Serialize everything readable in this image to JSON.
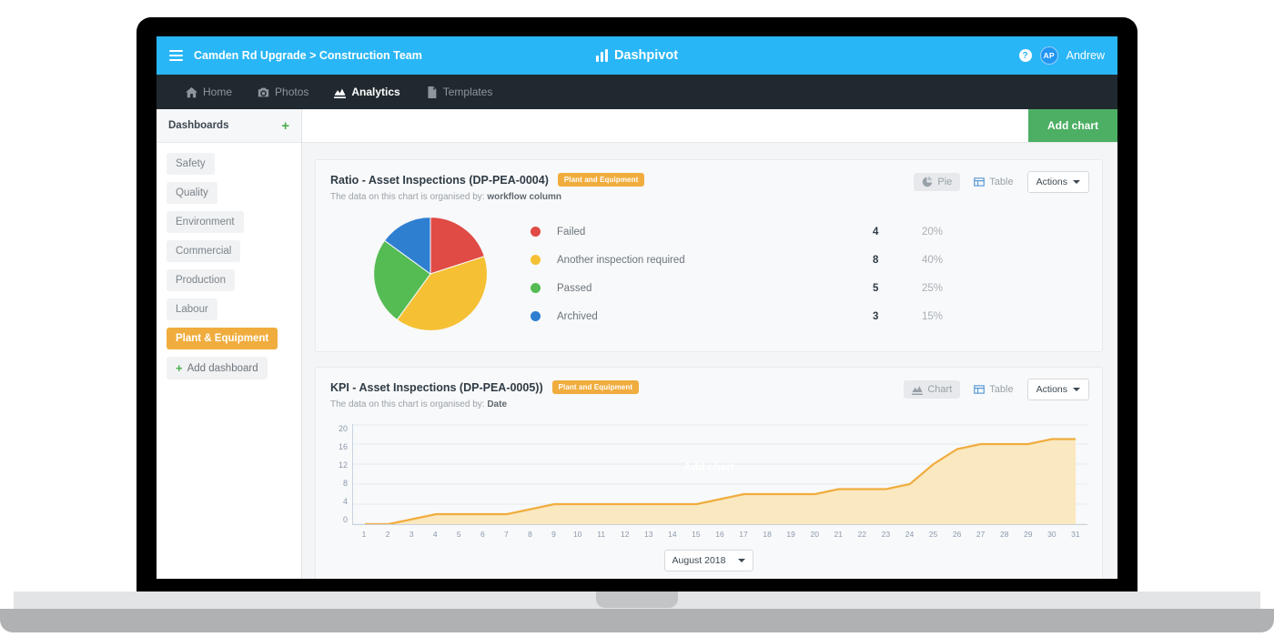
{
  "topbar": {
    "menu_icon": "hamburger-icon",
    "breadcrumb": "Camden Rd Upgrade > Construction Team",
    "brand": "Dashpivot",
    "help_icon": "?",
    "avatar_initials": "AP",
    "user_name": "Andrew"
  },
  "nav": {
    "items": [
      {
        "label": "Home",
        "icon": "home-icon",
        "active": false
      },
      {
        "label": "Photos",
        "icon": "camera-icon",
        "active": false
      },
      {
        "label": "Analytics",
        "icon": "analytics-icon",
        "active": true
      },
      {
        "label": "Templates",
        "icon": "document-icon",
        "active": false
      }
    ]
  },
  "sidebar": {
    "title": "Dashboards",
    "add_icon": "plus-icon",
    "items": [
      {
        "label": "Safety",
        "selected": false
      },
      {
        "label": "Quality",
        "selected": false
      },
      {
        "label": "Environment",
        "selected": false
      },
      {
        "label": "Commercial",
        "selected": false
      },
      {
        "label": "Production",
        "selected": false
      },
      {
        "label": "Labour",
        "selected": false
      },
      {
        "label": "Plant & Equipment",
        "selected": true
      }
    ],
    "add_dashboard_label": "Add dashboard"
  },
  "content_header": {
    "add_chart_label": "Add chart"
  },
  "cards": [
    {
      "title": "Ratio - Asset Inspections (DP-PEA-0004)",
      "tag": "Plant and Equipment",
      "subtitle_prefix": "The data on this chart is organised by:",
      "subtitle_value": "workflow column",
      "tools": {
        "view_label": "Pie",
        "view_icon": "pie-icon",
        "table_label": "Table",
        "table_icon": "table-icon",
        "actions_label": "Actions"
      }
    },
    {
      "title": "KPI - Asset Inspections (DP-PEA-0005))",
      "tag": "Plant and Equipment",
      "subtitle_prefix": "The data on this chart is organised by:",
      "subtitle_value": "Date",
      "tools": {
        "view_label": "Chart",
        "view_icon": "chart-icon",
        "table_label": "Table",
        "table_icon": "table-icon",
        "actions_label": "Actions"
      },
      "watermark": "Add chart",
      "month_selector": "August 2018"
    }
  ],
  "chart_data": [
    {
      "type": "pie",
      "title": "Ratio - Asset Inspections (DP-PEA-0004)",
      "legend_position": "right",
      "labels": [
        "Failed",
        "Another inspection required",
        "Passed",
        "Archived"
      ],
      "values": [
        4,
        8,
        5,
        3
      ],
      "percentages": [
        "20%",
        "40%",
        "25%",
        "15%"
      ],
      "colors": [
        "#e04b45",
        "#f5c033",
        "#55bc54",
        "#2f7fd1"
      ]
    },
    {
      "type": "area",
      "title": "KPI - Asset Inspections (DP-PEA-0005))",
      "xlabel": "",
      "ylabel": "",
      "ylim": [
        0,
        20
      ],
      "yticks": [
        20,
        16,
        12,
        8,
        4,
        0
      ],
      "grid": true,
      "color": "#f0ad3e",
      "fill": "#fae8c0",
      "x": [
        1,
        2,
        3,
        4,
        5,
        6,
        7,
        8,
        9,
        10,
        11,
        12,
        13,
        14,
        15,
        16,
        17,
        18,
        19,
        20,
        21,
        22,
        23,
        24,
        25,
        26,
        27,
        28,
        29,
        30,
        31
      ],
      "values": [
        0,
        0,
        1,
        2,
        2,
        2,
        2,
        3,
        4,
        4,
        4,
        4,
        4,
        4,
        4,
        5,
        6,
        6,
        6,
        6,
        7,
        7,
        7,
        8,
        12,
        15,
        16,
        16,
        16,
        17,
        17
      ]
    }
  ]
}
